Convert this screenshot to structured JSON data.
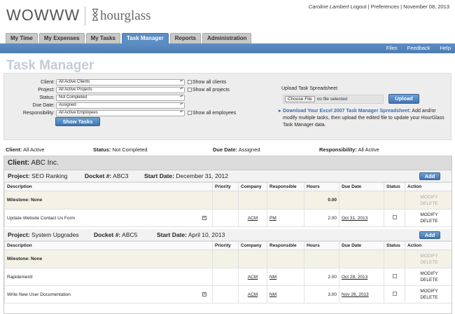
{
  "header": {
    "logo_left": "WOWWW",
    "logo_right": "hourglass",
    "user_name": "Caroline Lambert",
    "logout": "Logout",
    "preferences": "Preferences",
    "date": "November 08, 2013"
  },
  "tabs": [
    "My Time",
    "My Expenses",
    "My Tasks",
    "Task Manager",
    "Reports",
    "Administration"
  ],
  "active_tab": "Task Manager",
  "menubar": {
    "files": "Files",
    "feedback": "Feedback",
    "help": "Help"
  },
  "page_title": "Task Manager",
  "filters": {
    "client": {
      "label": "Client:",
      "value": "All Active Clients",
      "checkbox": "Show all clients"
    },
    "project": {
      "label": "Project:",
      "value": "All Active Projects",
      "checkbox": "Show all projects"
    },
    "status": {
      "label": "Status:",
      "value": "Not Completed"
    },
    "due_date": {
      "label": "Due Date:",
      "value": "Assigned"
    },
    "responsibility": {
      "label": "Responsibility:",
      "value": "All Active Employees",
      "checkbox": "Show all employees"
    },
    "show_tasks": "Show Tasks"
  },
  "upload": {
    "title": "Upload Task Spreadsheet",
    "choose": "Choose File",
    "no_file": "no file selected",
    "upload_btn": "Upload",
    "download_link": "Download Your Excel 2007 Task Manager Spreadsheet:",
    "download_text": "Add and/or modify multiple tasks, then upload the edited file to update your HourGlass Task Manager data."
  },
  "summary": {
    "client_label": "Client:",
    "client_value": "All Active",
    "status_label": "Status:",
    "status_value": "Not Completed",
    "due_label": "Due Date:",
    "due_value": "Assigned",
    "resp_label": "Responsibility:",
    "resp_value": "All Active"
  },
  "client": {
    "label": "Client:",
    "name": "ABC Inc."
  },
  "columns": [
    "Description",
    "Priority",
    "Company",
    "Responsible",
    "Hours",
    "Due Date",
    "Status",
    "Action"
  ],
  "action_labels": {
    "modify": "MODIFY",
    "delete": "DELETE",
    "add": "Add"
  },
  "projects": [
    {
      "project_label": "Project:",
      "project": "SEO Ranking",
      "docket_label": "Docket #:",
      "docket": "ABC3",
      "start_label": "Start Date:",
      "start": "December 31, 2012",
      "milestone": "Milestone: None",
      "milestone_hours": "0.00",
      "tasks": [
        {
          "description": "Update Website Contact Us Form",
          "priority": "",
          "company": "ACM",
          "responsible": "PM",
          "hours": "2.00",
          "due": "Oct 31, 2013"
        }
      ]
    },
    {
      "project_label": "Project:",
      "project": "System Upgrades",
      "docket_label": "Docket #:",
      "docket": "ABC5",
      "start_label": "Start Date:",
      "start": "April 10, 2013",
      "milestone": "Milestone: None",
      "milestone_hours": "",
      "tasks": [
        {
          "description": "Rapidement!",
          "priority": "",
          "company": "ACM",
          "responsible": "NM",
          "hours": "2.00",
          "due": "Oct 28, 2013"
        },
        {
          "description": "Write New User Documentation",
          "priority": "",
          "company": "ACM",
          "responsible": "NM",
          "hours": "3.00",
          "due": "Nov 26, 2013"
        }
      ]
    }
  ],
  "colors": {
    "tab_active": "#5d8ec3",
    "page_title": "#c2ccd7",
    "link": "#3a6db0",
    "milestone_bg": "#f4f1e6"
  }
}
